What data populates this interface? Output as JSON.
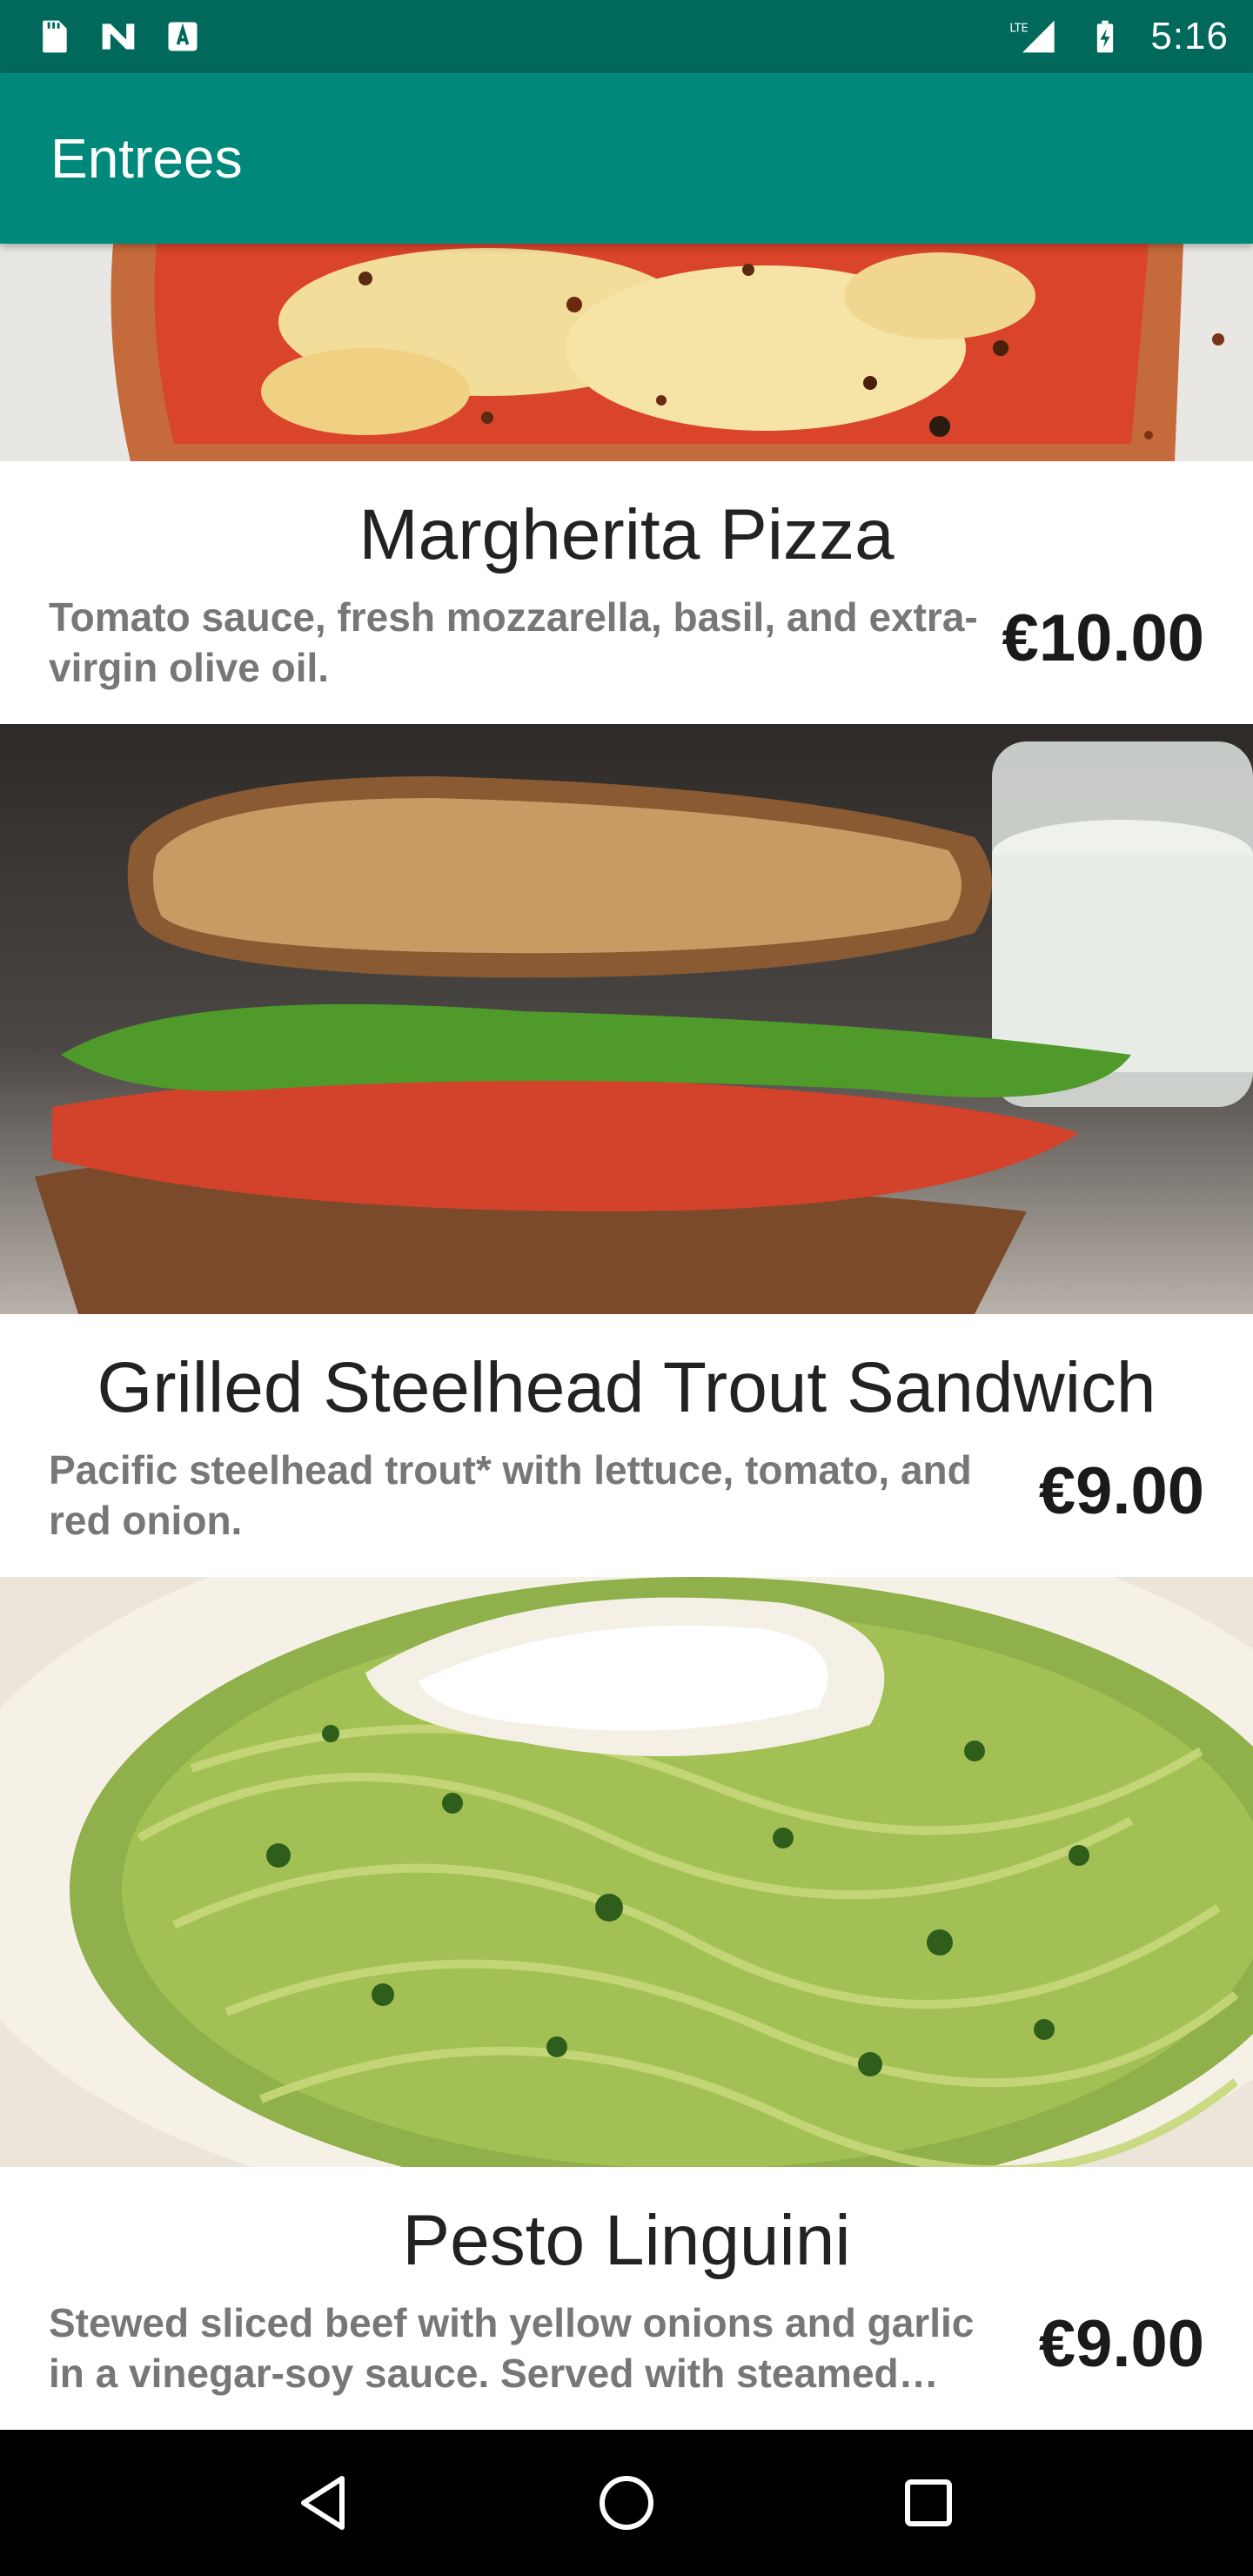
{
  "status_bar": {
    "time": "5:16",
    "left_icons": [
      "sd-card-icon",
      "notification-n-icon",
      "text-a-icon"
    ],
    "network_label": "LTE",
    "battery_icon": "battery-charging-icon"
  },
  "app_bar": {
    "title": "Entrees",
    "color": "#00897b",
    "status_color": "#00695c"
  },
  "menu": {
    "items": [
      {
        "name": "Margherita Pizza",
        "description": "Tomato sauce, fresh mozzarella, basil, and extra-virgin olive oil.",
        "price": "€10.00",
        "photo_icon": "pizza-photo"
      },
      {
        "name": "Grilled Steelhead Trout Sandwich",
        "description": "Pacific steelhead trout* with lettuce, tomato, and red onion.",
        "price": "€9.00",
        "photo_icon": "sandwich-photo"
      },
      {
        "name": "Pesto Linguini",
        "description": "Stewed sliced beef with yellow onions and garlic in a vinegar-soy sauce. Served with steamed jasmine rice.",
        "price": "€9.00",
        "photo_icon": "pasta-photo"
      }
    ]
  },
  "nav_bar": {
    "back_icon": "back-triangle-icon",
    "home_icon": "home-circle-icon",
    "recents_icon": "recents-square-icon"
  }
}
